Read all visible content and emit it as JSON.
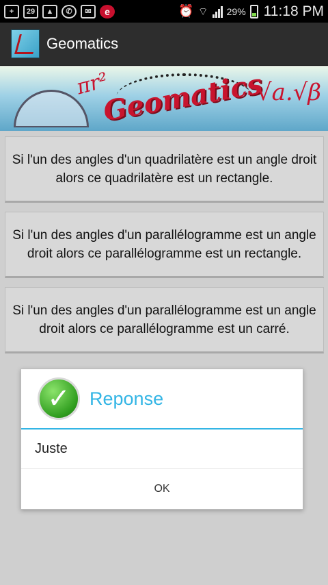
{
  "status_bar": {
    "notification_count": "29",
    "battery_percent": "29%",
    "time": "11:18 PM",
    "icons": [
      "plus-icon",
      "calendar-icon",
      "image-icon",
      "whatsapp-icon",
      "mail-icon",
      "e-app-icon",
      "alarm-icon",
      "wifi-icon",
      "signal-icon",
      "battery-icon"
    ]
  },
  "action_bar": {
    "title": "Geomatics"
  },
  "banner": {
    "word": "Geomatics",
    "formula_left": "πr²",
    "formula_right": "√a.√β"
  },
  "answers": [
    "Si l'un des angles d'un quadrilatère est un angle droit  alors ce  quadrilatère est un rectangle.",
    "Si l'un des angles d'un parallélogramme est un angle droit  alors ce parallélogramme est un rectangle.",
    "Si l'un des angles d'un parallélogramme est un angle droit  alors ce parallélogramme est un carré."
  ],
  "dialog": {
    "title": "Reponse",
    "message": "Juste",
    "ok_label": "OK"
  },
  "colors": {
    "accent": "#33b5e5",
    "banner_red": "#c8142e",
    "check_green": "#2f9d1e"
  }
}
